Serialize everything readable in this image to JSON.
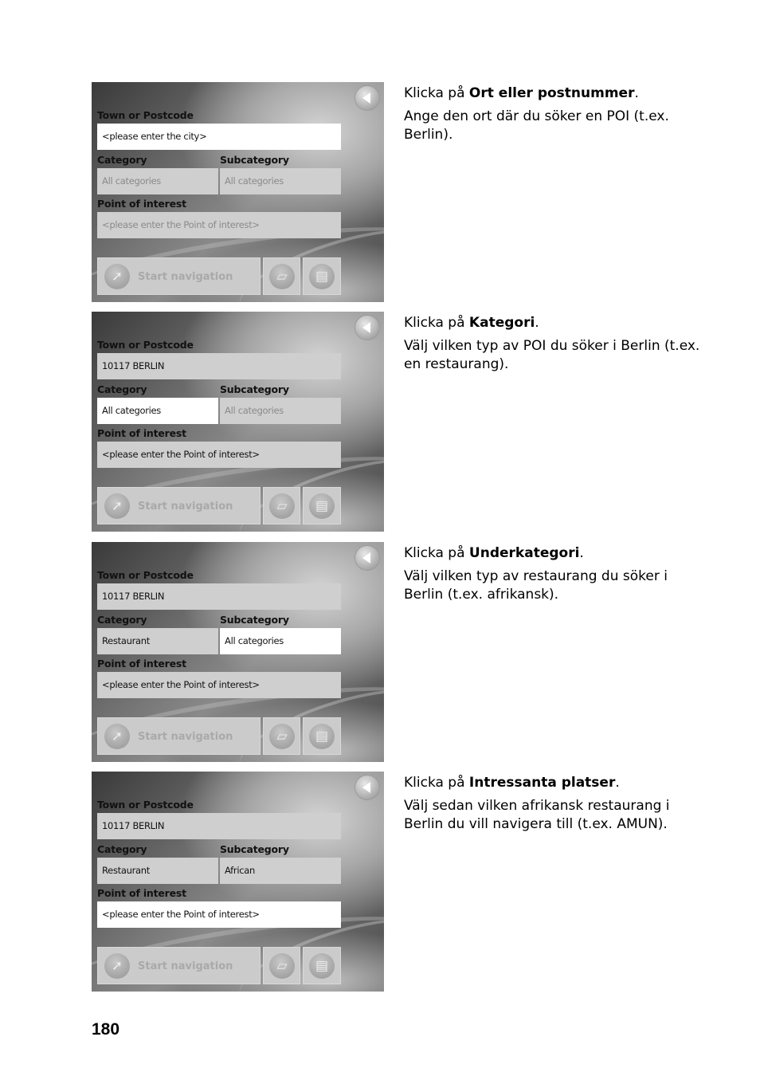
{
  "steps": [
    {
      "screen": {
        "town_label": "Town or Postcode",
        "town_value": "<please enter the city>",
        "category_label": "Category",
        "category_value": "All categories",
        "subcategory_label": "Subcategory",
        "subcategory_value": "All categories",
        "poi_label": "Point of interest",
        "poi_value": "<please enter the Point of interest>",
        "start_nav_label": "Start navigation"
      },
      "instruction": {
        "prefix": "Klicka på ",
        "bold": "Ort eller postnummer",
        "suffix": ".",
        "detail": "Ange den ort där du söker en POI (t.ex. Berlin)."
      }
    },
    {
      "screen": {
        "town_label": "Town or Postcode",
        "town_value": "10117 BERLIN",
        "category_label": "Category",
        "category_value": "All categories",
        "subcategory_label": "Subcategory",
        "subcategory_value": "All categories",
        "poi_label": "Point of interest",
        "poi_value": "<please enter the Point of interest>",
        "start_nav_label": "Start navigation"
      },
      "instruction": {
        "prefix": "Klicka på ",
        "bold": "Kategori",
        "suffix": ".",
        "detail": "Välj vilken typ av POI du söker i Berlin (t.ex. en restaurang)."
      }
    },
    {
      "screen": {
        "town_label": "Town or Postcode",
        "town_value": "10117 BERLIN",
        "category_label": "Category",
        "category_value": "Restaurant",
        "subcategory_label": "Subcategory",
        "subcategory_value": "All categories",
        "poi_label": "Point of interest",
        "poi_value": "<please enter the Point of interest>",
        "start_nav_label": "Start navigation"
      },
      "instruction": {
        "prefix": "Klicka på ",
        "bold": "Underkategori",
        "suffix": ".",
        "detail": "Välj vilken typ av restaurang du söker i Berlin (t.ex. afrikansk)."
      }
    },
    {
      "screen": {
        "town_label": "Town or Postcode",
        "town_value": "10117 BERLIN",
        "category_label": "Category",
        "category_value": "Restaurant",
        "subcategory_label": "Subcategory",
        "subcategory_value": "African",
        "poi_label": "Point of interest",
        "poi_value": "<please enter the Point of interest>",
        "start_nav_label": "Start navigation"
      },
      "instruction": {
        "prefix": "Klicka på ",
        "bold": "Intressanta platser",
        "suffix": ".",
        "detail": "Välj sedan vilken afrikansk restaurang i Berlin du vill navigera till (t.ex. AMUN)."
      }
    }
  ],
  "page_number": "180"
}
